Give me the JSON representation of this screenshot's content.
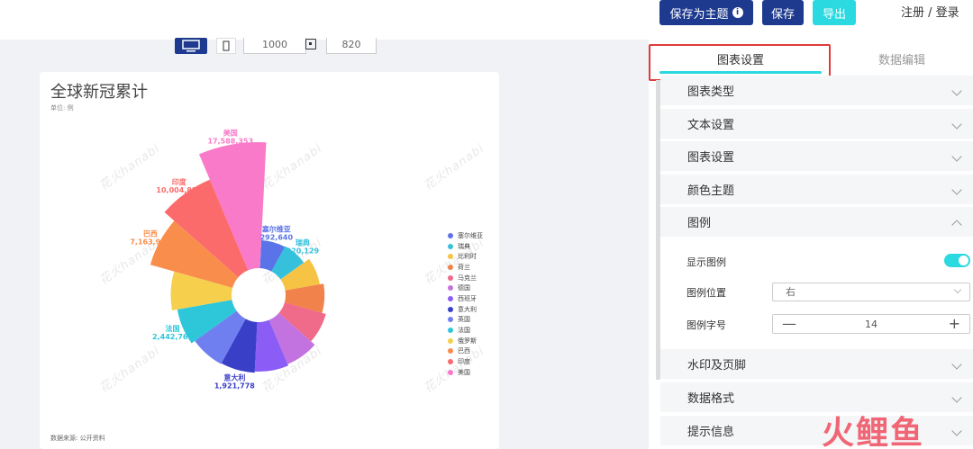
{
  "header": {
    "save_theme_label": "保存为主题",
    "save_label": "保存",
    "export_label": "导出",
    "auth_label": "注册 / 登录"
  },
  "toolbar": {
    "width_value": "1000",
    "height_value": "820"
  },
  "chart_card": {
    "title": "全球新冠累计",
    "unit": "单位: 例",
    "source": "数据来源: 公开资料",
    "watermark": "花火hanabi"
  },
  "chart_data": {
    "type": "nightingale-rose",
    "title": "全球新冠累计",
    "unit": "单位: 例",
    "categories": [
      "塞尔维亚",
      "瑞典",
      "比利时",
      "荷兰",
      "马克兰",
      "德国",
      "西班牙",
      "意大利",
      "英国",
      "法国",
      "俄罗斯",
      "巴西",
      "印度",
      "美国"
    ],
    "values": [
      292640,
      320129,
      650000,
      900000,
      1200000,
      1650000,
      1800000,
      1921778,
      2000000,
      2442766,
      3100000,
      7163912,
      10004825,
      17588353
    ],
    "colors": [
      "#5b73e8",
      "#35c1dc",
      "#f6c344",
      "#f2824b",
      "#f06a8a",
      "#c373e0",
      "#8b5cf6",
      "#3a3fc8",
      "#6f7ff0",
      "#2ec7d9",
      "#f6d04d",
      "#f98e4c",
      "#fb6b6b",
      "#f97ac8"
    ],
    "labels": [
      {
        "name": "塞尔维亚",
        "value": "292,640"
      },
      {
        "name": "瑞典",
        "value": "320,129"
      },
      {
        "name": "意大利",
        "value": "1,921,778"
      },
      {
        "name": "法国",
        "value": "2,442,766"
      },
      {
        "name": "巴西",
        "value": "7,163,912"
      },
      {
        "name": "印度",
        "value": "10,004,825"
      },
      {
        "name": "美国",
        "value": "17,588,353"
      }
    ],
    "legend_position": "right"
  },
  "panel": {
    "tab_chart": "图表设置",
    "tab_data": "数据编辑",
    "sections": [
      "图表类型",
      "文本设置",
      "图表设置",
      "颜色主题",
      "图例",
      "水印及页脚",
      "数据格式",
      "提示信息"
    ],
    "legend_show_label": "显示图例",
    "legend_show_on": true,
    "legend_position_label": "图例位置",
    "legend_position_value": "右",
    "legend_font_label": "图例字号",
    "legend_font_value": "14",
    "minus": "—",
    "plus": "+"
  },
  "logo_text": "火鲤鱼",
  "colors": {
    "primary": "#1d3a8f",
    "accent": "#2bd9e0",
    "highlight": "#e03a3a"
  }
}
